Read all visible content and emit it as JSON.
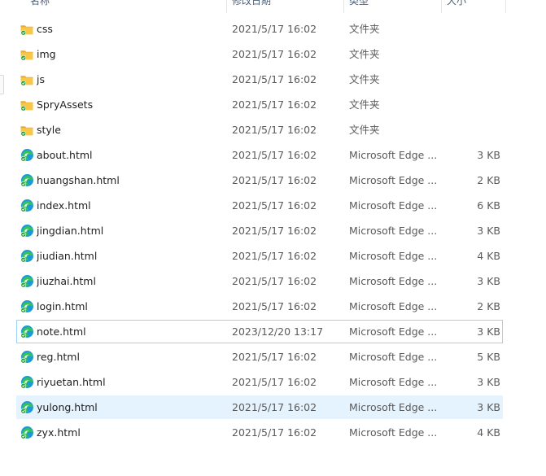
{
  "columns": {
    "name": "名称",
    "modified": "修改日期",
    "type": "类型",
    "size": "大小"
  },
  "icons": {
    "folder": "folder-icon",
    "file": "microsoft-edge-html-icon"
  },
  "colors": {
    "folder_yellow": "#f8c745",
    "sync_green": "#2e9e3e",
    "selection_bg": "#e5f3ff",
    "focus_border": "#99d1ff"
  },
  "files": [
    {
      "name": "css",
      "modified": "2021/5/17 16:02",
      "type": "文件夹",
      "size": "",
      "kind": "folder"
    },
    {
      "name": "img",
      "modified": "2021/5/17 16:02",
      "type": "文件夹",
      "size": "",
      "kind": "folder"
    },
    {
      "name": "js",
      "modified": "2021/5/17 16:02",
      "type": "文件夹",
      "size": "",
      "kind": "folder"
    },
    {
      "name": "SpryAssets",
      "modified": "2021/5/17 16:02",
      "type": "文件夹",
      "size": "",
      "kind": "folder"
    },
    {
      "name": "style",
      "modified": "2021/5/17 16:02",
      "type": "文件夹",
      "size": "",
      "kind": "folder"
    },
    {
      "name": "about.html",
      "modified": "2021/5/17 16:02",
      "type": "Microsoft Edge ...",
      "size": "3 KB",
      "kind": "file"
    },
    {
      "name": "huangshan.html",
      "modified": "2021/5/17 16:02",
      "type": "Microsoft Edge ...",
      "size": "2 KB",
      "kind": "file"
    },
    {
      "name": "index.html",
      "modified": "2021/5/17 16:02",
      "type": "Microsoft Edge ...",
      "size": "6 KB",
      "kind": "file"
    },
    {
      "name": "jingdian.html",
      "modified": "2021/5/17 16:02",
      "type": "Microsoft Edge ...",
      "size": "3 KB",
      "kind": "file"
    },
    {
      "name": "jiudian.html",
      "modified": "2021/5/17 16:02",
      "type": "Microsoft Edge ...",
      "size": "4 KB",
      "kind": "file"
    },
    {
      "name": "jiuzhai.html",
      "modified": "2021/5/17 16:02",
      "type": "Microsoft Edge ...",
      "size": "3 KB",
      "kind": "file"
    },
    {
      "name": "login.html",
      "modified": "2021/5/17 16:02",
      "type": "Microsoft Edge ...",
      "size": "2 KB",
      "kind": "file"
    },
    {
      "name": "note.html",
      "modified": "2023/12/20 13:17",
      "type": "Microsoft Edge ...",
      "size": "3 KB",
      "kind": "file",
      "state": "focus"
    },
    {
      "name": "reg.html",
      "modified": "2021/5/17 16:02",
      "type": "Microsoft Edge ...",
      "size": "5 KB",
      "kind": "file"
    },
    {
      "name": "riyuetan.html",
      "modified": "2021/5/17 16:02",
      "type": "Microsoft Edge ...",
      "size": "3 KB",
      "kind": "file"
    },
    {
      "name": "yulong.html",
      "modified": "2021/5/17 16:02",
      "type": "Microsoft Edge ...",
      "size": "3 KB",
      "kind": "file",
      "state": "hover"
    },
    {
      "name": "zyx.html",
      "modified": "2021/5/17 16:02",
      "type": "Microsoft Edge ...",
      "size": "4 KB",
      "kind": "file"
    }
  ]
}
